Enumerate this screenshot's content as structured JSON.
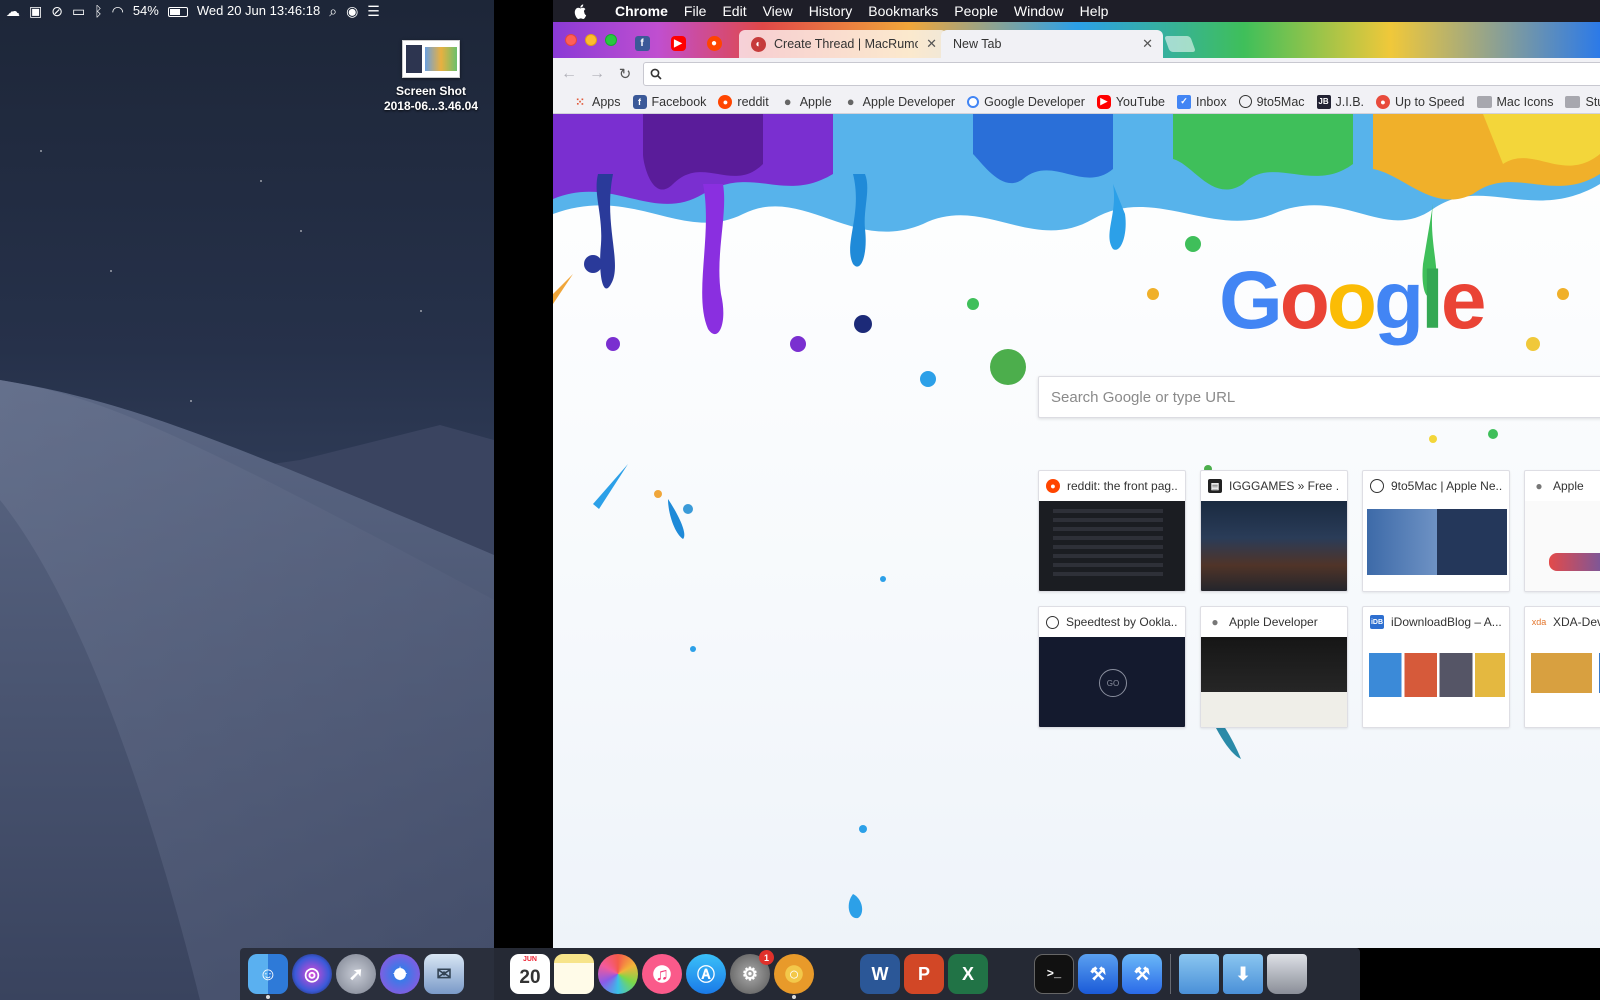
{
  "menubar_left": {
    "battery_percent": "54%",
    "clock": "Wed 20 Jun  13:46:18"
  },
  "desktop": {
    "file": {
      "name_line1": "Screen Shot",
      "name_line2": "2018-06...3.46.04"
    }
  },
  "app_menu": {
    "app_name": "Chrome",
    "items": [
      "File",
      "Edit",
      "View",
      "History",
      "Bookmarks",
      "People",
      "Window",
      "Help"
    ]
  },
  "tabs": {
    "pinned": [
      {
        "icon": "facebook-icon"
      },
      {
        "icon": "youtube-icon"
      },
      {
        "icon": "reddit-icon"
      }
    ],
    "background_tab": {
      "title": "Create Thread | MacRumors Fo",
      "icon": "macrumors-icon"
    },
    "active_tab": {
      "title": "New Tab"
    }
  },
  "omnibox": {
    "value": ""
  },
  "bookmarks": [
    {
      "label": "Apps",
      "icon": "apps-grid-icon"
    },
    {
      "label": "Facebook",
      "icon": "facebook-icon"
    },
    {
      "label": "reddit",
      "icon": "reddit-icon"
    },
    {
      "label": "Apple",
      "icon": "apple-icon"
    },
    {
      "label": "Apple Developer",
      "icon": "apple-icon"
    },
    {
      "label": "Google Developer",
      "icon": "google-icon"
    },
    {
      "label": "YouTube",
      "icon": "youtube-icon"
    },
    {
      "label": "Inbox",
      "icon": "inbox-icon"
    },
    {
      "label": "9to5Mac",
      "icon": "clock-icon"
    },
    {
      "label": "J.I.B.",
      "icon": "jib-icon"
    },
    {
      "label": "Up to Speed",
      "icon": "speed-icon"
    },
    {
      "label": "Mac Icons",
      "icon": "folder-icon"
    },
    {
      "label": "Stuff",
      "icon": "folder-icon"
    }
  ],
  "ntp": {
    "logo_letters": [
      "G",
      "o",
      "o",
      "g",
      "l",
      "e"
    ],
    "search_placeholder": "Search Google or type URL",
    "tiles": [
      {
        "title": "reddit: the front pag...",
        "icon": "reddit-icon"
      },
      {
        "title": "IGGGAMES » Free ...",
        "icon": "igggames-icon"
      },
      {
        "title": "9to5Mac | Apple Ne...",
        "icon": "clock-icon"
      },
      {
        "title": "Apple",
        "icon": "apple-icon"
      },
      {
        "title": "Speedtest by Ookla...",
        "icon": "speedtest-icon"
      },
      {
        "title": "Apple Developer",
        "icon": "apple-icon"
      },
      {
        "title": "iDownloadBlog – A...",
        "icon": "idownloadblog-icon"
      },
      {
        "title": "XDA-Dev",
        "icon": "xda-icon"
      }
    ]
  },
  "dock": {
    "calendar": {
      "month": "JUN",
      "day": "20"
    },
    "badge_count": "1",
    "items": [
      "Finder",
      "Siri",
      "Launchpad",
      "Safari",
      "Mail",
      "Calendar",
      "Notes",
      "Photos",
      "iTunes",
      "App Store",
      "System Preferences",
      "Chrome",
      "Word",
      "PowerPoint",
      "Excel",
      "Terminal",
      "Xcode",
      "Instruments",
      "Documents folder",
      "Downloads folder",
      "Trash"
    ]
  },
  "colors": {
    "google_blue": "#4285f4",
    "google_red": "#ea4335",
    "google_yellow": "#fbbc05",
    "google_green": "#34a853",
    "menubar_dark": "#1e1e28"
  }
}
